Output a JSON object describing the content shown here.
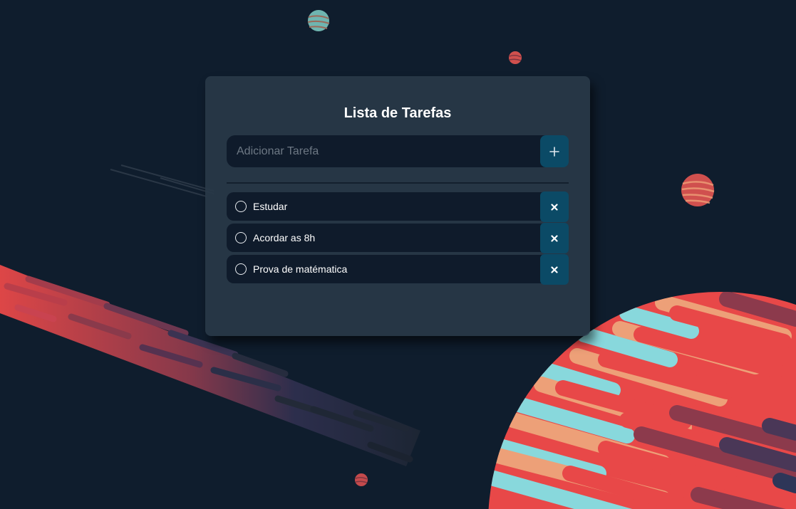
{
  "card": {
    "title": "Lista de Tarefas"
  },
  "add_task": {
    "placeholder": "Adicionar Tarefa",
    "value": "",
    "button_icon": "plus-icon"
  },
  "tasks": [
    {
      "label": "Estudar",
      "completed": false
    },
    {
      "label": "Acordar as 8h",
      "completed": false
    },
    {
      "label": "Prova de matématica",
      "completed": false
    }
  ],
  "colors": {
    "background": "#0f1d2d",
    "card": "#283848",
    "input": "#0f1b2b",
    "accent_button": "#0b4a66",
    "planet_red": "#e84848",
    "planet_peach": "#eda078",
    "planet_cyan": "#88d8dc"
  }
}
